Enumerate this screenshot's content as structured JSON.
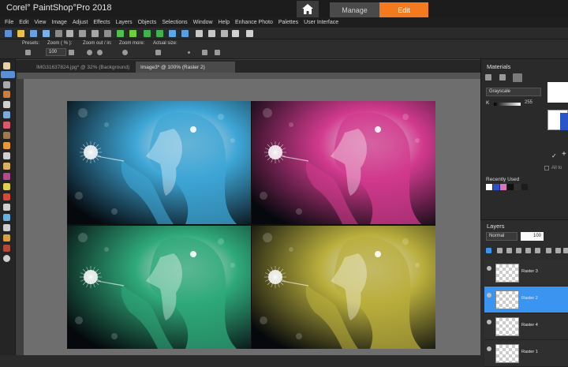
{
  "app": {
    "title": "Corel° PaintShop°Pro 2018"
  },
  "workspace_tabs": {
    "manage": "Manage",
    "edit": "Edit"
  },
  "menu": [
    "File",
    "Edit",
    "View",
    "Image",
    "Adjust",
    "Effects",
    "Layers",
    "Objects",
    "Selections",
    "Window",
    "Help",
    "Enhance Photo",
    "Palettes",
    "User Interface"
  ],
  "options": {
    "presets_label": "Presets:",
    "zoom_pct_label": "Zoom ( % ):",
    "zoom_value": "100",
    "zoom_out_in_label": "Zoom out / in:",
    "zoom_more_label": "Zoom more:",
    "actual_size_label": "Actual size:"
  },
  "documents": {
    "tab1": "IMG31637824.jpg* @  32% (Background)",
    "tab2": "Image3* @ 100% (Raster 2)"
  },
  "materials": {
    "title": "Materials",
    "mode": "Grayscale",
    "k_label": "K",
    "k_value": "255",
    "all_tools": "All to",
    "recently_used_label": "Recently Used",
    "recent_colors": [
      "#ffffff",
      "#2850c8",
      "#e070c0",
      "#101010",
      "#303030",
      "#1c1c1c"
    ]
  },
  "layers": {
    "title": "Layers",
    "blend_mode": "Normal",
    "opacity": "100",
    "items": [
      {
        "name": "Raster 3",
        "selected": false
      },
      {
        "name": "Raster 2",
        "selected": true
      },
      {
        "name": "Raster 4",
        "selected": false
      },
      {
        "name": "Raster 1",
        "selected": false
      }
    ]
  },
  "image_tints": {
    "top_left": "#3ea6d6",
    "top_right": "#d23a8e",
    "bottom_left": "#2fa97a",
    "bottom_right": "#b9ae3c"
  }
}
